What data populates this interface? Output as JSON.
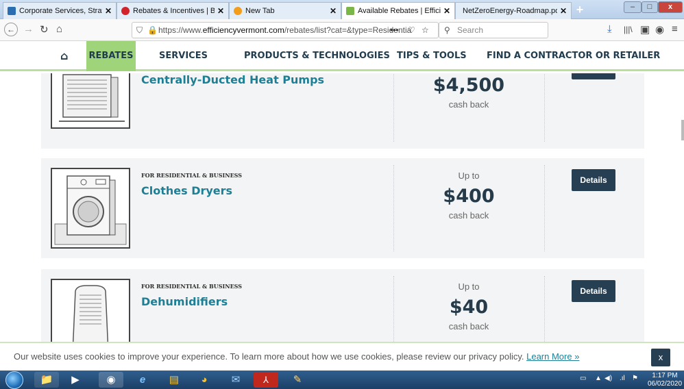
{
  "browser": {
    "tabs": [
      {
        "title": "Corporate Services, Strategy, R",
        "icon_color": "#2a6db0"
      },
      {
        "title": "Rebates & Incentives | Burlingt",
        "icon_color": "#d2232a"
      },
      {
        "title": "New Tab",
        "icon_color": "#f29d1b"
      },
      {
        "title": "Available Rebates | Efficiency V",
        "icon_color": "#7ab648"
      },
      {
        "title": "NetZeroEnergy-Roadmap.pdf",
        "icon_color": "#cccccc"
      }
    ],
    "new_tab_label": "+",
    "url_prefix": "https://www.",
    "url_domain": "efficiencyvermont.com",
    "url_rest": "/rebates/list?cat=&type=Residentia",
    "search_placeholder": "Search",
    "more_label": "•••",
    "win_min": "–",
    "win_max": "□",
    "win_close": "x"
  },
  "site_nav": {
    "home_icon": "home-icon",
    "items": [
      "REBATES",
      "SERVICES",
      "PRODUCTS & TECHNOLOGIES",
      "TIPS & TOOLS",
      "FIND A CONTRACTOR OR RETAILER"
    ],
    "active": "REBATES"
  },
  "products": [
    {
      "eyebrow": "",
      "title": "Centrally-Ducted Heat Pumps",
      "up_to": "",
      "amount": "$4,500",
      "unit": "cash back",
      "button": ""
    },
    {
      "eyebrow": "FOR RESIDENTIAL & BUSINESS",
      "title": "Clothes Dryers",
      "up_to": "Up to",
      "amount": "$400",
      "unit": "cash back",
      "button": "Details"
    },
    {
      "eyebrow": "FOR RESIDENTIAL & BUSINESS",
      "title": "Dehumidifiers",
      "up_to": "Up to",
      "amount": "$40",
      "unit": "cash back",
      "button": "Details"
    }
  ],
  "cookie": {
    "text": "Our website uses cookies to improve your experience. To learn more about how we use cookies, please review our privacy policy. ",
    "link": "Learn More »",
    "close": "x"
  },
  "taskbar": {
    "time": "1:17 PM",
    "date": "06/02/2020"
  },
  "colors": {
    "accent_green": "#9fd47a",
    "title_teal": "#1d7f95",
    "button_navy": "#263f53"
  }
}
